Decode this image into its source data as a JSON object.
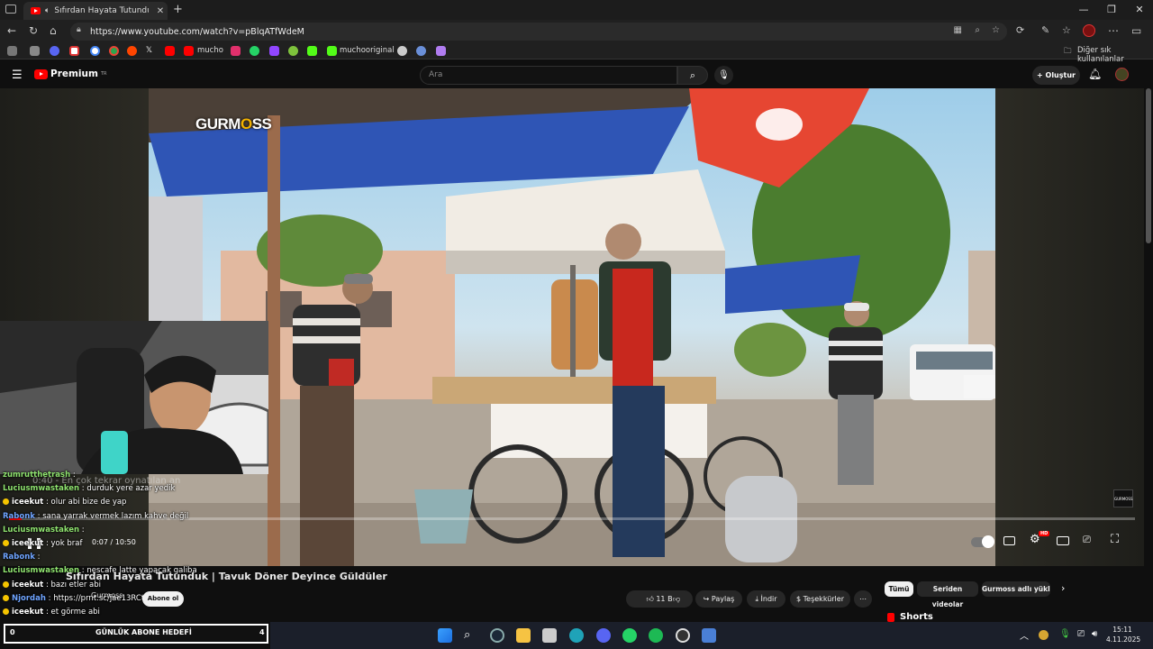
{
  "browser": {
    "tab_title": "Sıfırdan Hayata Tutunduk | T",
    "url": "https://www.youtube.com/watch?v=pBlqATfWdeM",
    "bookmarks": [
      "mucho",
      "muchooriginal"
    ],
    "other_bookmarks": "Diğer sık kullanılanlar"
  },
  "youtube": {
    "logo_text": "Premium",
    "logo_sup": "TR",
    "search_placeholder": "Ara",
    "create_label": "Oluştur"
  },
  "video": {
    "watermark": "GURMOSS",
    "watermark_highlight": "O",
    "time_current": "0:07",
    "time_total": "10:50",
    "progress_fraction": 0.011,
    "replay_text": "0:40 - En çok tekrar oynatılan an",
    "quality_badge": "HD",
    "title": "Sıfırdan Hayata Tutunduk | Tavuk Döner Deyince Güldüler",
    "channel": "Gurmoss",
    "subscribe_label": "Abone ol",
    "likes": "11 B",
    "share_label": "Paylaş",
    "download_label": "İndir",
    "thanks_label": "Teşekkürler",
    "shorts_label": "Shorts"
  },
  "chips": [
    "Tümü",
    "Seriden videolar",
    "Gurmoss adlı yükleyici"
  ],
  "chat": [
    {
      "user": "zumrutthetrash",
      "msg": "",
      "color": "green",
      "badge": false
    },
    {
      "user": "Luciusmwastaken",
      "msg": "durduk yere azar yedik",
      "color": "green",
      "badge": false
    },
    {
      "user": "iceekut",
      "msg": "olur abi bize de yap",
      "color": "white",
      "badge": true
    },
    {
      "user": "Rabonk",
      "msg": "sana yarrak vermek lazım kahve değil",
      "color": "blue",
      "badge": false
    },
    {
      "user": "Luciusmwastaken",
      "msg": "",
      "color": "green",
      "badge": false
    },
    {
      "user": "iceekut",
      "msg": "yok braf",
      "color": "white",
      "badge": true
    },
    {
      "user": "Rabonk",
      "msg": "",
      "color": "blue",
      "badge": false
    },
    {
      "user": "Luciusmwastaken",
      "msg": "nescafe latte yapacak galiba",
      "color": "green",
      "badge": false
    },
    {
      "user": "iceekut",
      "msg": "bazı etler abi",
      "color": "white",
      "badge": true
    },
    {
      "user": "Njordah",
      "msg": "https://prnt.sc/jae13RCtt0PG",
      "color": "blue",
      "badge": true
    },
    {
      "user": "iceekut",
      "msg": "et görme abi",
      "color": "white",
      "badge": true
    }
  ],
  "goal": {
    "label": "GÜNLÜK ABONE HEDEFİ",
    "current": "0",
    "target": "4"
  },
  "clock": {
    "time": "15:11",
    "date": "4.11.2025"
  },
  "colors": {
    "accent": "#ff0000",
    "background": "#0f0f0f"
  }
}
